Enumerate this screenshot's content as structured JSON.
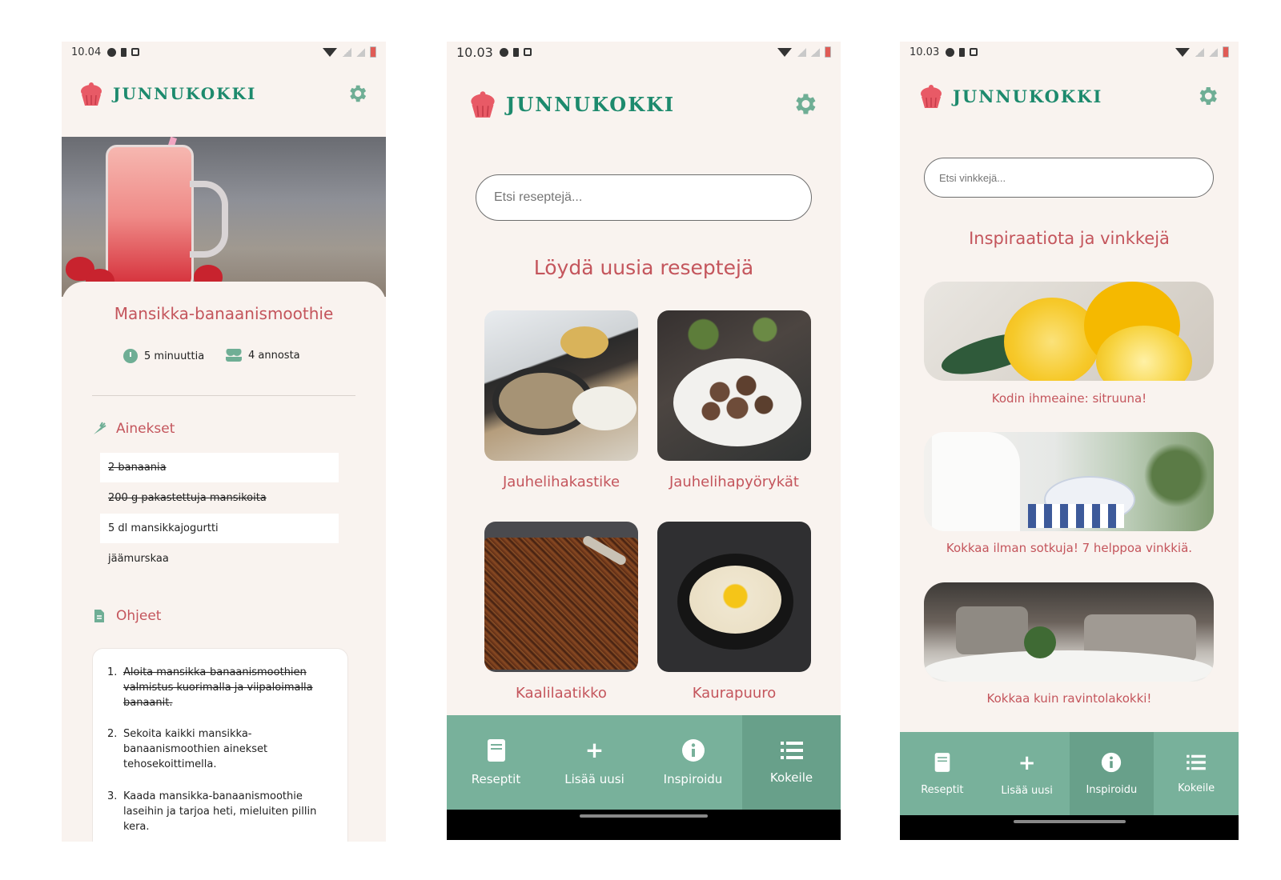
{
  "screens": [
    {
      "status": {
        "time": "10.04"
      },
      "brand": "JUNNUKOKKI",
      "recipe": {
        "title": "Mansikka-banaanismoothie",
        "time": "5 minuuttia",
        "servings": "4 annosta",
        "ingredients_title": "Ainekset",
        "ingredients": [
          {
            "text": "2 banaania",
            "checked": true
          },
          {
            "text": "200 g pakastettuja mansikoita",
            "checked": true
          },
          {
            "text": "5 dl mansikkajogurtti",
            "checked": false
          },
          {
            "text": "jäämurskaa",
            "checked": false
          }
        ],
        "instructions_title": "Ohjeet",
        "steps": [
          {
            "num": "1.",
            "text": "Aloita mansikka-banaanismoothien valmistus kuorimalla ja viipaloimalla banaanit.",
            "checked": true
          },
          {
            "num": "2.",
            "text": "Sekoita kaikki mansikka-banaanismoothien ainekset tehosekoittimella.",
            "checked": false
          },
          {
            "num": "3.",
            "text": "Kaada mansikka-banaanismoothie laseihin ja tarjoa heti, mieluiten pillin kera.",
            "checked": false
          }
        ]
      }
    },
    {
      "status": {
        "time": "10.03"
      },
      "brand": "JUNNUKOKKI",
      "search_placeholder": "Etsi reseptejä...",
      "section_title": "Löydä uusia reseptejä",
      "recipes": [
        {
          "label": "Jauhelihakastike"
        },
        {
          "label": "Jauhelihapyörykät"
        },
        {
          "label": "Kaalilaatikko"
        },
        {
          "label": "Kaurapuuro"
        }
      ],
      "nav": [
        {
          "label": "Reseptit",
          "icon": "book-icon"
        },
        {
          "label": "Lisää uusi",
          "icon": "plus-icon"
        },
        {
          "label": "Inspiroidu",
          "icon": "info-icon"
        },
        {
          "label": "Kokeile",
          "icon": "list-icon",
          "active": true
        }
      ]
    },
    {
      "status": {
        "time": "10.03"
      },
      "brand": "JUNNUKOKKI",
      "search_placeholder": "Etsi vinkkejä...",
      "section_title": "Inspiraatiota ja vinkkejä",
      "articles": [
        {
          "label": "Kodin ihmeaine: sitruuna!"
        },
        {
          "label": "Kokkaa ilman sotkuja! 7 helppoa vinkkiä."
        },
        {
          "label": "Kokkaa kuin ravintolakokki!"
        }
      ],
      "nav": [
        {
          "label": "Reseptit",
          "icon": "book-icon"
        },
        {
          "label": "Lisää uusi",
          "icon": "plus-icon"
        },
        {
          "label": "Inspiroidu",
          "icon": "info-icon",
          "active": true
        },
        {
          "label": "Kokeile",
          "icon": "list-icon"
        }
      ]
    }
  ],
  "colors": {
    "background": "#f9f3ef",
    "brand_green": "#1d8a6d",
    "accent_red": "#c4555c",
    "nav_green": "#78b19b",
    "nav_active": "#68a08a",
    "icon_green": "#6fae95"
  }
}
